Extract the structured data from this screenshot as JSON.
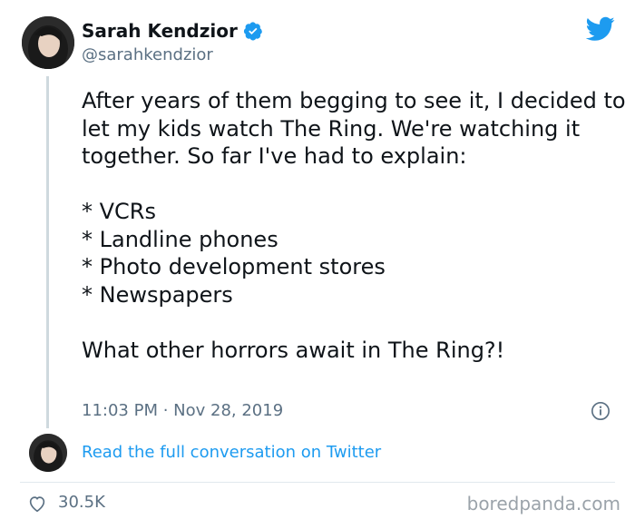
{
  "tweet": {
    "display_name": "Sarah Kendzior",
    "handle": "@sarahkendzior",
    "verified_icon": "verified-badge-icon",
    "text": "After years of them begging to see it, I decided to let my kids watch The Ring. We're watching it together. So far I've had to explain:\n\n* VCRs\n* Landline phones\n* Photo development stores\n* Newspapers\n\nWhat other horrors await in The Ring?!",
    "timestamp": "11:03 PM · Nov 28, 2019"
  },
  "footer": {
    "full_conversation_label": "Read the full conversation on Twitter",
    "likes": "30.5K"
  },
  "watermark": "boredpanda.com",
  "colors": {
    "link": "#1d9bf0",
    "verified": "#1d9bf0",
    "muted": "#5b7083",
    "twitter_blue": "#1d9bf0"
  }
}
